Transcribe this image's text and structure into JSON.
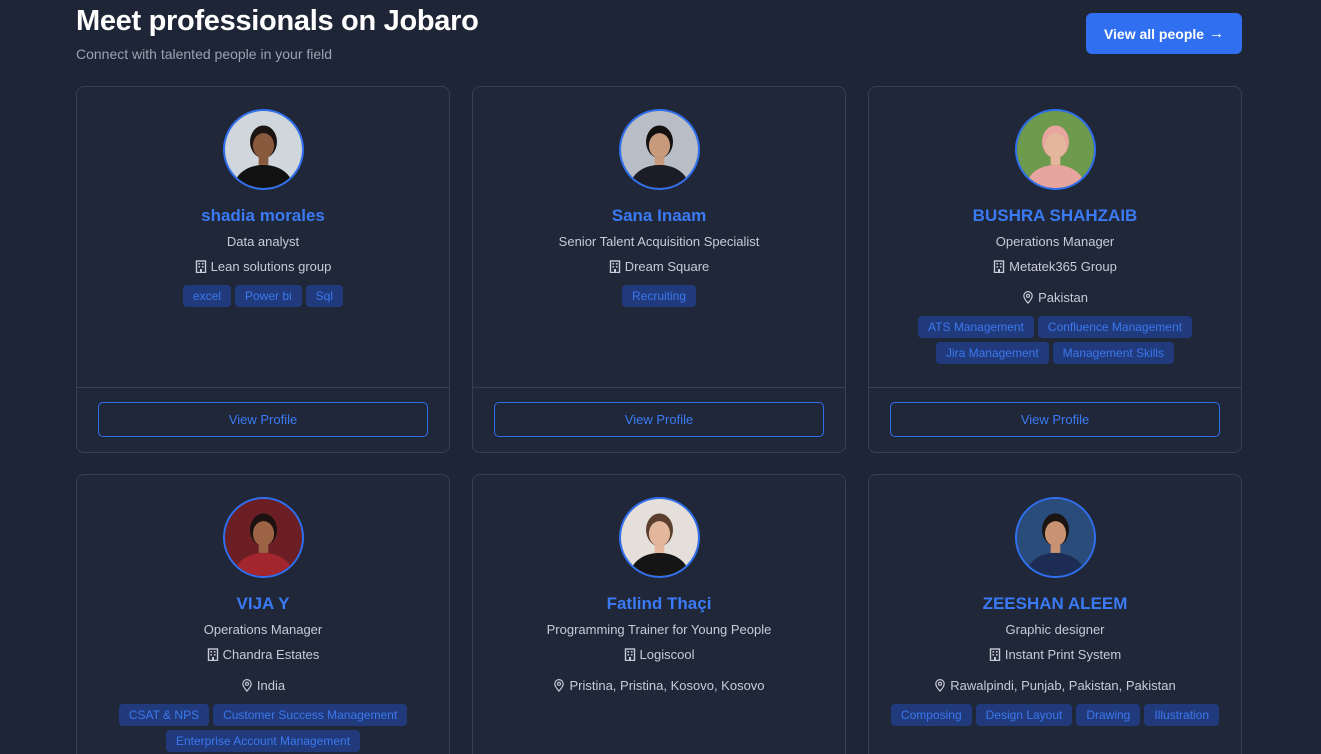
{
  "header": {
    "title": "Meet professionals on Jobaro",
    "subtitle": "Connect with talented people in your field",
    "view_all_label": "View all people",
    "view_all_arrow": "→"
  },
  "colors": {
    "accent": "#2f6ff0",
    "name": "#3b7af5",
    "tag_bg": "#203a7c",
    "bg": "#1e2536"
  },
  "view_profile_label": "View Profile",
  "cards": [
    {
      "name": "shadia morales",
      "role": "Data analyst",
      "company": "Lean solutions group",
      "location": "",
      "tags": [
        "excel",
        "Power bi",
        "Sql"
      ]
    },
    {
      "name": "Sana Inaam",
      "role": "Senior Talent Acquisition Specialist",
      "company": "Dream Square",
      "location": "",
      "tags": [
        "Recruiting"
      ]
    },
    {
      "name": "BUSHRA SHAHZAIB",
      "role": "Operations Manager",
      "company": "Metatek365 Group",
      "location": "Pakistan",
      "tags": [
        "ATS Management",
        "Confluence Management",
        "Jira Management",
        "Management Skills"
      ]
    },
    {
      "name": "VIJA Y",
      "role": "Operations Manager",
      "company": "Chandra Estates",
      "location": "India",
      "tags": [
        "CSAT & NPS",
        "Customer Success Management",
        "Enterprise Account Management"
      ]
    },
    {
      "name": "Fatlind Thaçi",
      "role": "Programming Trainer for Young People",
      "company": "Logiscool",
      "location": "Pristina, Pristina, Kosovo, Kosovo",
      "tags": []
    },
    {
      "name": "ZEESHAN ALEEM",
      "role": "Graphic designer",
      "company": "Instant Print System",
      "location": "Rawalpindi, Punjab, Pakistan, Pakistan",
      "tags": [
        "Composing",
        "Design Layout",
        "Drawing",
        "Illustration"
      ]
    }
  ]
}
